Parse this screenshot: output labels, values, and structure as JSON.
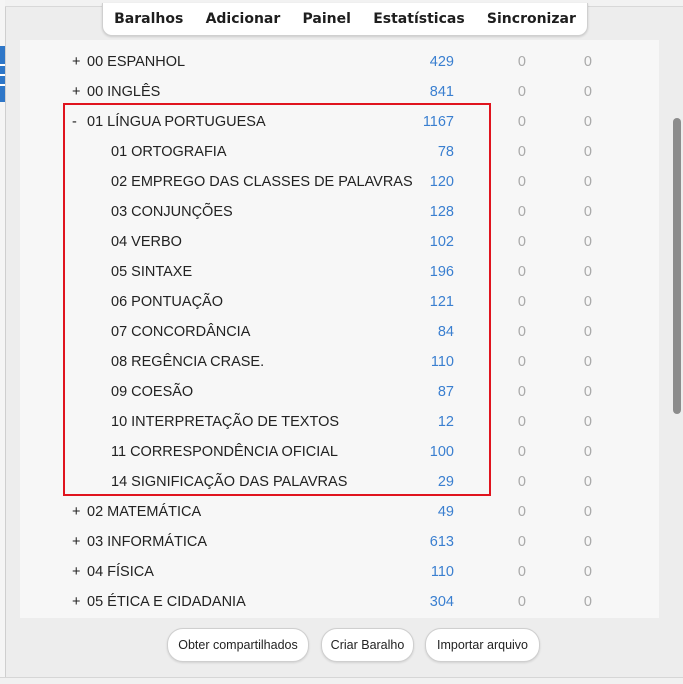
{
  "toolbar": {
    "decks_label": "Baralhos",
    "add_label": "Adicionar",
    "browse_label": "Painel",
    "stats_label": "Estatísticas",
    "sync_label": "Sincronizar"
  },
  "decks": [
    {
      "expander": "+",
      "name": "00 ESPANHOL",
      "new": "429",
      "learn": "0",
      "due": "0",
      "level": 0
    },
    {
      "expander": "+",
      "name": "00 INGLÊS",
      "new": "841",
      "learn": "0",
      "due": "0",
      "level": 0
    },
    {
      "expander": "-",
      "name": "01 LÍNGUA PORTUGUESA",
      "new": "1167",
      "learn": "0",
      "due": "0",
      "level": 0
    },
    {
      "expander": "",
      "name": "01 ORTOGRAFIA",
      "new": "78",
      "learn": "0",
      "due": "0",
      "level": 1
    },
    {
      "expander": "",
      "name": "02 EMPREGO DAS CLASSES DE PALAVRAS",
      "new": "120",
      "learn": "0",
      "due": "0",
      "level": 1
    },
    {
      "expander": "",
      "name": "03 CONJUNÇÕES",
      "new": "128",
      "learn": "0",
      "due": "0",
      "level": 1
    },
    {
      "expander": "",
      "name": "04 VERBO",
      "new": "102",
      "learn": "0",
      "due": "0",
      "level": 1
    },
    {
      "expander": "",
      "name": "05 SINTAXE",
      "new": "196",
      "learn": "0",
      "due": "0",
      "level": 1
    },
    {
      "expander": "",
      "name": "06 PONTUAÇÃO",
      "new": "121",
      "learn": "0",
      "due": "0",
      "level": 1
    },
    {
      "expander": "",
      "name": "07 CONCORDÂNCIA",
      "new": "84",
      "learn": "0",
      "due": "0",
      "level": 1
    },
    {
      "expander": "",
      "name": "08 REGÊNCIA CRASE.",
      "new": "110",
      "learn": "0",
      "due": "0",
      "level": 1
    },
    {
      "expander": "",
      "name": "09 COESÃO",
      "new": "87",
      "learn": "0",
      "due": "0",
      "level": 1
    },
    {
      "expander": "",
      "name": "10 INTERPRETAÇÃO DE TEXTOS",
      "new": "12",
      "learn": "0",
      "due": "0",
      "level": 1
    },
    {
      "expander": "",
      "name": "11 CORRESPONDÊNCIA OFICIAL",
      "new": "100",
      "learn": "0",
      "due": "0",
      "level": 1
    },
    {
      "expander": "",
      "name": "14 SIGNIFICAÇÃO DAS PALAVRAS",
      "new": "29",
      "learn": "0",
      "due": "0",
      "level": 1
    },
    {
      "expander": "+",
      "name": "02 MATEMÁTICA",
      "new": "49",
      "learn": "0",
      "due": "0",
      "level": 0
    },
    {
      "expander": "+",
      "name": "03 INFORMÁTICA",
      "new": "613",
      "learn": "0",
      "due": "0",
      "level": 0
    },
    {
      "expander": "+",
      "name": "04 FÍSICA",
      "new": "110",
      "learn": "0",
      "due": "0",
      "level": 0
    },
    {
      "expander": "+",
      "name": "05 ÉTICA E CIDADANIA",
      "new": "304",
      "learn": "0",
      "due": "0",
      "level": 0
    }
  ],
  "bottom": {
    "shared_label": "Obter compartilhados",
    "create_label": "Criar Baralho",
    "import_label": "Importar arquivo"
  },
  "colors": {
    "new_count": "#3a7fd0",
    "zero_count": "#a9a9a9",
    "highlight": "#e0141e"
  }
}
